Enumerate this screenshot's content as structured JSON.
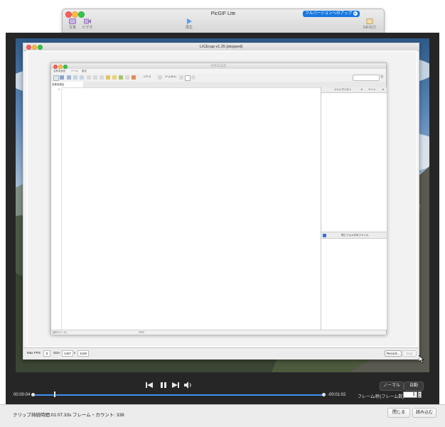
{
  "picgif": {
    "title": "PicGIF Lite",
    "upgrade_label": "フルバージョンへのアップ",
    "toolbar": [
      {
        "label": "写真",
        "icon": "photo-icon"
      },
      {
        "label": "ビデオ",
        "icon": "video-icon"
      },
      {
        "label": "再生",
        "icon": "play-icon"
      },
      {
        "label": "GIF出力",
        "icon": "gif-export-icon"
      }
    ]
  },
  "licecap": {
    "title": "LICEcap v1.25 [stopped]",
    "max_fps_label": "Max FPS:",
    "max_fps_value": "8",
    "size_label": "Size:",
    "width_value": "1457",
    "x_label": "x",
    "height_value": "1109",
    "record_label": "Record...",
    "stop_label": "Stop"
  },
  "editor": {
    "title": "名称未設定",
    "menu": [
      "名称未設定",
      "ツール",
      "設定"
    ],
    "toolbar_labels": [
      "UTF-8",
      "LF (UNIX)"
    ],
    "tab_label": "名称未設定",
    "line_number": "1",
    "jump_list_label": "ジャンプリスト",
    "sort_label": "ソート",
    "folder_label": "同じフォルダのファイル",
    "status_text": "[改行コード]"
  },
  "player": {
    "mode_normal": "ノーマル",
    "mode_auto": "自動",
    "time_current": "00:00:04",
    "time_remaining": "-00:01:02",
    "fps_label": "フレーム/秒(フレーム数)",
    "fps_value": "5",
    "progress": 0.02,
    "clip_marker": 0.07
  },
  "footer": {
    "clip_duration": "クリップ持続時間:01:07.33s",
    "frame_count": "フレーム・カウント: 338",
    "close_label": "閉じる",
    "import_label": "読み込む"
  }
}
